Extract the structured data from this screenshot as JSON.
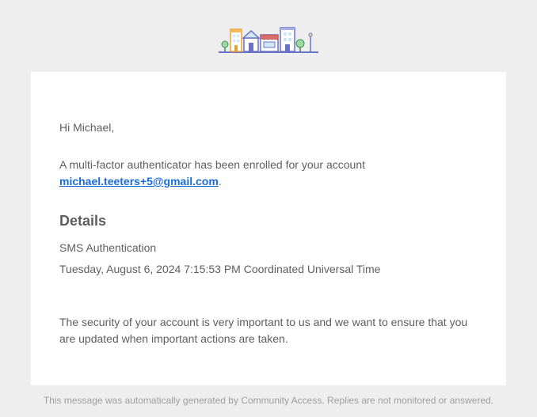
{
  "greeting": "Hi Michael,",
  "enrolled_text_before": "A multi-factor authenticator has been enrolled for your account ",
  "account_email": "michael.teeters+5@gmail.com",
  "enrolled_text_after": ".",
  "details_heading": "Details",
  "auth_method": "SMS Authentication",
  "timestamp": "Tuesday, August 6, 2024 7:15:53 PM Coordinated Universal Time",
  "security_note": "The security of your account is very important to us and we want to ensure that you are updated when important actions are taken.",
  "footer": "This message was automatically generated by Community Access. Replies are not monitored or answered."
}
